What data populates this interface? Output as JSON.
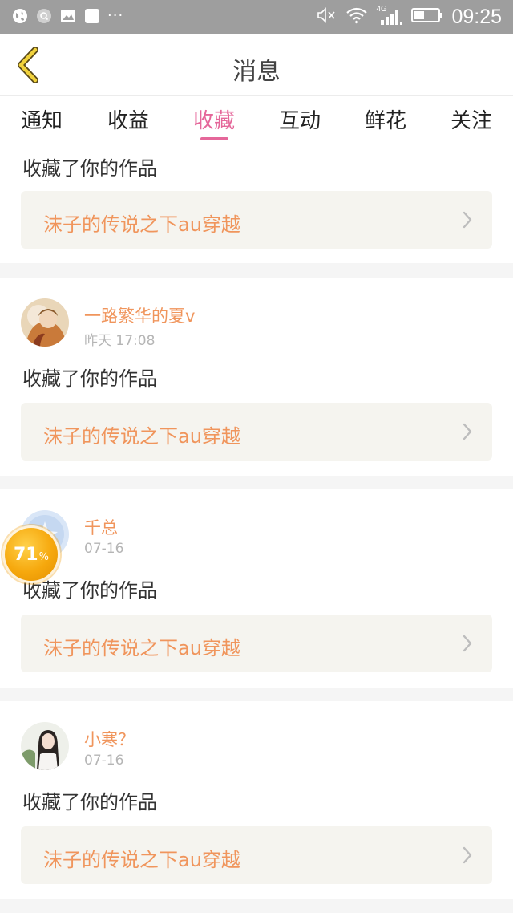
{
  "status_bar": {
    "time": "09:25",
    "network": "4G",
    "left_icons": [
      "globe-icon",
      "search-bubble-icon",
      "image-icon",
      "app-square-icon",
      "more-dots-icon"
    ],
    "right_icons": [
      "mute-icon",
      "wifi-icon",
      "cellular-signal-icon",
      "battery-icon"
    ],
    "more_dots": "···"
  },
  "header": {
    "title": "消息",
    "back_icon": "back-chevron-icon"
  },
  "tabs": [
    {
      "label": "通知",
      "active": false
    },
    {
      "label": "收益",
      "active": false
    },
    {
      "label": "收藏",
      "active": true
    },
    {
      "label": "互动",
      "active": false
    },
    {
      "label": "鲜花",
      "active": false
    },
    {
      "label": "关注",
      "active": false
    }
  ],
  "messages": [
    {
      "action": "收藏了你的作品",
      "work_title": "沫子的传说之下au穿越"
    },
    {
      "user_name": "一路繁华的夏v",
      "time": "昨天 17:08",
      "action": "收藏了你的作品",
      "work_title": "沫子的传说之下au穿越"
    },
    {
      "user_name": "千总",
      "time": "07-16",
      "action": "收藏了你的作品",
      "work_title": "沫子的传说之下au穿越"
    },
    {
      "user_name": "小寒？",
      "time": "07-16",
      "action": "收藏了你的作品",
      "work_title": "沫子的传说之下au穿越"
    }
  ],
  "floating_progress": {
    "value": "71",
    "unit": "%"
  },
  "colors": {
    "accent_pink": "#e5679a",
    "orange_text": "#f0955c",
    "status_bar": "#9e9e9e"
  }
}
